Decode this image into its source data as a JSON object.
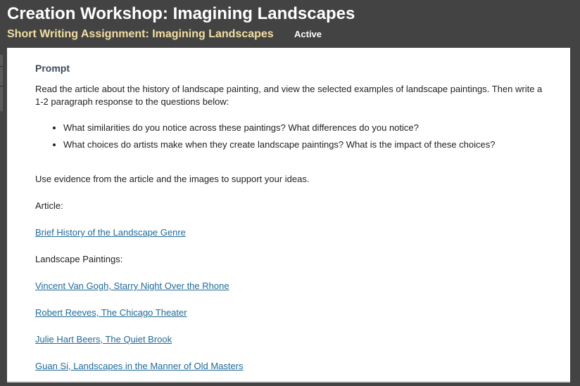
{
  "header": {
    "course_title": "Creation Workshop: Imagining Landscapes",
    "assignment_title": "Short Writing Assignment: Imagining Landscapes",
    "status": "Active"
  },
  "prompt": {
    "heading": "Prompt",
    "intro": "Read the article about the history of landscape painting, and view the selected examples of landscape paintings. Then write a 1-2 paragraph response to the questions below:",
    "questions": [
      "What similarities do you notice across these paintings? What differences do you notice?",
      "What choices do artists make when they create landscape paintings? What is the impact of these choices?"
    ],
    "evidence_note": "Use evidence from the article and the images to support your ideas.",
    "article_label": "Article:",
    "article_link": "Brief History of the Landscape Genre",
    "paintings_label": "Landscape Paintings:",
    "painting_links": [
      "Vincent Van Gogh, Starry Night Over the Rhone",
      "Robert Reeves, The Chicago Theater",
      "Julie Hart Beers, The Quiet Brook",
      "Guan Si, Landscapes in the Manner of Old Masters"
    ]
  },
  "colors": {
    "header_bg": "#434343",
    "assignment_title": "#f3dfa2",
    "link": "#1f6a9a",
    "heading": "#3d4b5a"
  }
}
